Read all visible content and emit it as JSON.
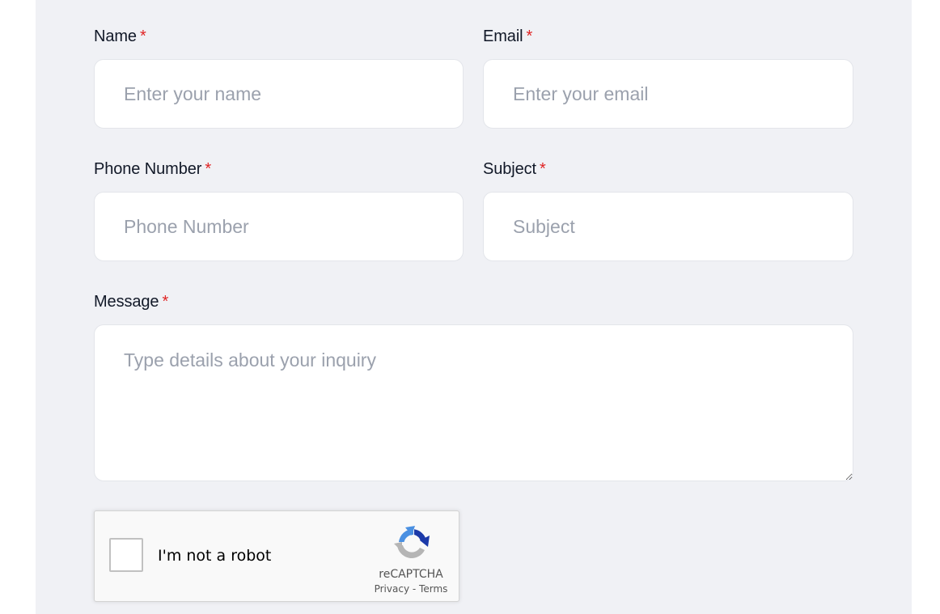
{
  "form": {
    "name": {
      "label": "Name",
      "required_mark": "*",
      "placeholder": "Enter your name",
      "value": ""
    },
    "email": {
      "label": "Email",
      "required_mark": "*",
      "placeholder": "Enter your email",
      "value": ""
    },
    "phone": {
      "label": "Phone Number",
      "required_mark": "*",
      "placeholder": "Phone Number",
      "value": ""
    },
    "subject": {
      "label": "Subject",
      "required_mark": "*",
      "placeholder": "Subject",
      "value": ""
    },
    "message": {
      "label": "Message",
      "required_mark": "*",
      "placeholder": "Type details about your inquiry",
      "value": ""
    }
  },
  "recaptcha": {
    "checkbox_label": "I'm not a robot",
    "checked": false,
    "brand": "reCAPTCHA",
    "privacy_link": "Privacy",
    "separator": "-",
    "terms_link": "Terms",
    "icon": "recaptcha-logo-icon"
  },
  "colors": {
    "panel_background": "#f0f1f5",
    "required_asterisk": "#e02424",
    "label_text": "#111827",
    "placeholder_text": "#9ba1ad",
    "input_background": "#ffffff",
    "input_border": "#e3e5ea"
  }
}
